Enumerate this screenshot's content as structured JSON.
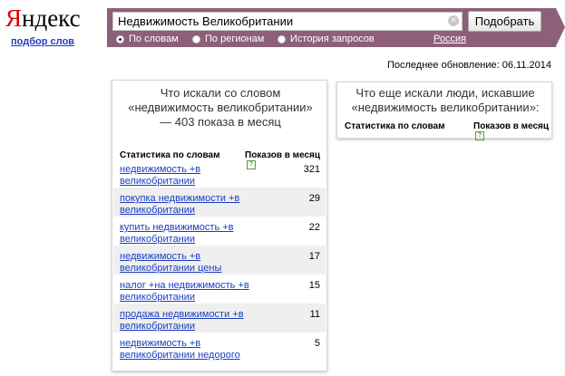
{
  "header": {
    "logo_first": "Я",
    "logo_rest": "ндекс",
    "wordstat_link": "подбор слов",
    "search_value": "Недвижимость Великобритании",
    "clear_glyph": "×",
    "submit_label": "Подобрать",
    "radios": [
      {
        "label": "По словам",
        "checked": true
      },
      {
        "label": "По регионам",
        "checked": false
      },
      {
        "label": "История запросов",
        "checked": false
      }
    ],
    "region_label": "Россия"
  },
  "updated": "Последнее обновление: 06.11.2014",
  "left_panel": {
    "title": "Что искали со словом «недвижимость великобритании» — 403 показа в месяц",
    "col_words": "Статистика по словам",
    "col_count": "Показов в месяц",
    "help_glyph": "?",
    "rows": [
      {
        "phrase": "недвижимость +в великобритании",
        "count": "321"
      },
      {
        "phrase": "покупка недвижимости +в великобритании",
        "count": "29"
      },
      {
        "phrase": "купить недвижимость +в великобритании",
        "count": "22"
      },
      {
        "phrase": "недвижимость +в великобритании цены",
        "count": "17"
      },
      {
        "phrase": "налог +на недвижимость +в великобритании",
        "count": "15"
      },
      {
        "phrase": "продажа недвижимости +в великобритании",
        "count": "11"
      },
      {
        "phrase": "недвижимость +в великобритании недорого",
        "count": "5"
      }
    ]
  },
  "right_panel": {
    "title": "Что еще искали люди, искавшие «недвижимость великобритании»:",
    "col_words": "Статистика по словам",
    "col_count": "Показов в месяц",
    "help_glyph": "?"
  },
  "colors": {
    "band": "#8e5f79",
    "link": "#1a3dc1",
    "logo_red": "#e00000",
    "row_shade": "#efefef"
  }
}
